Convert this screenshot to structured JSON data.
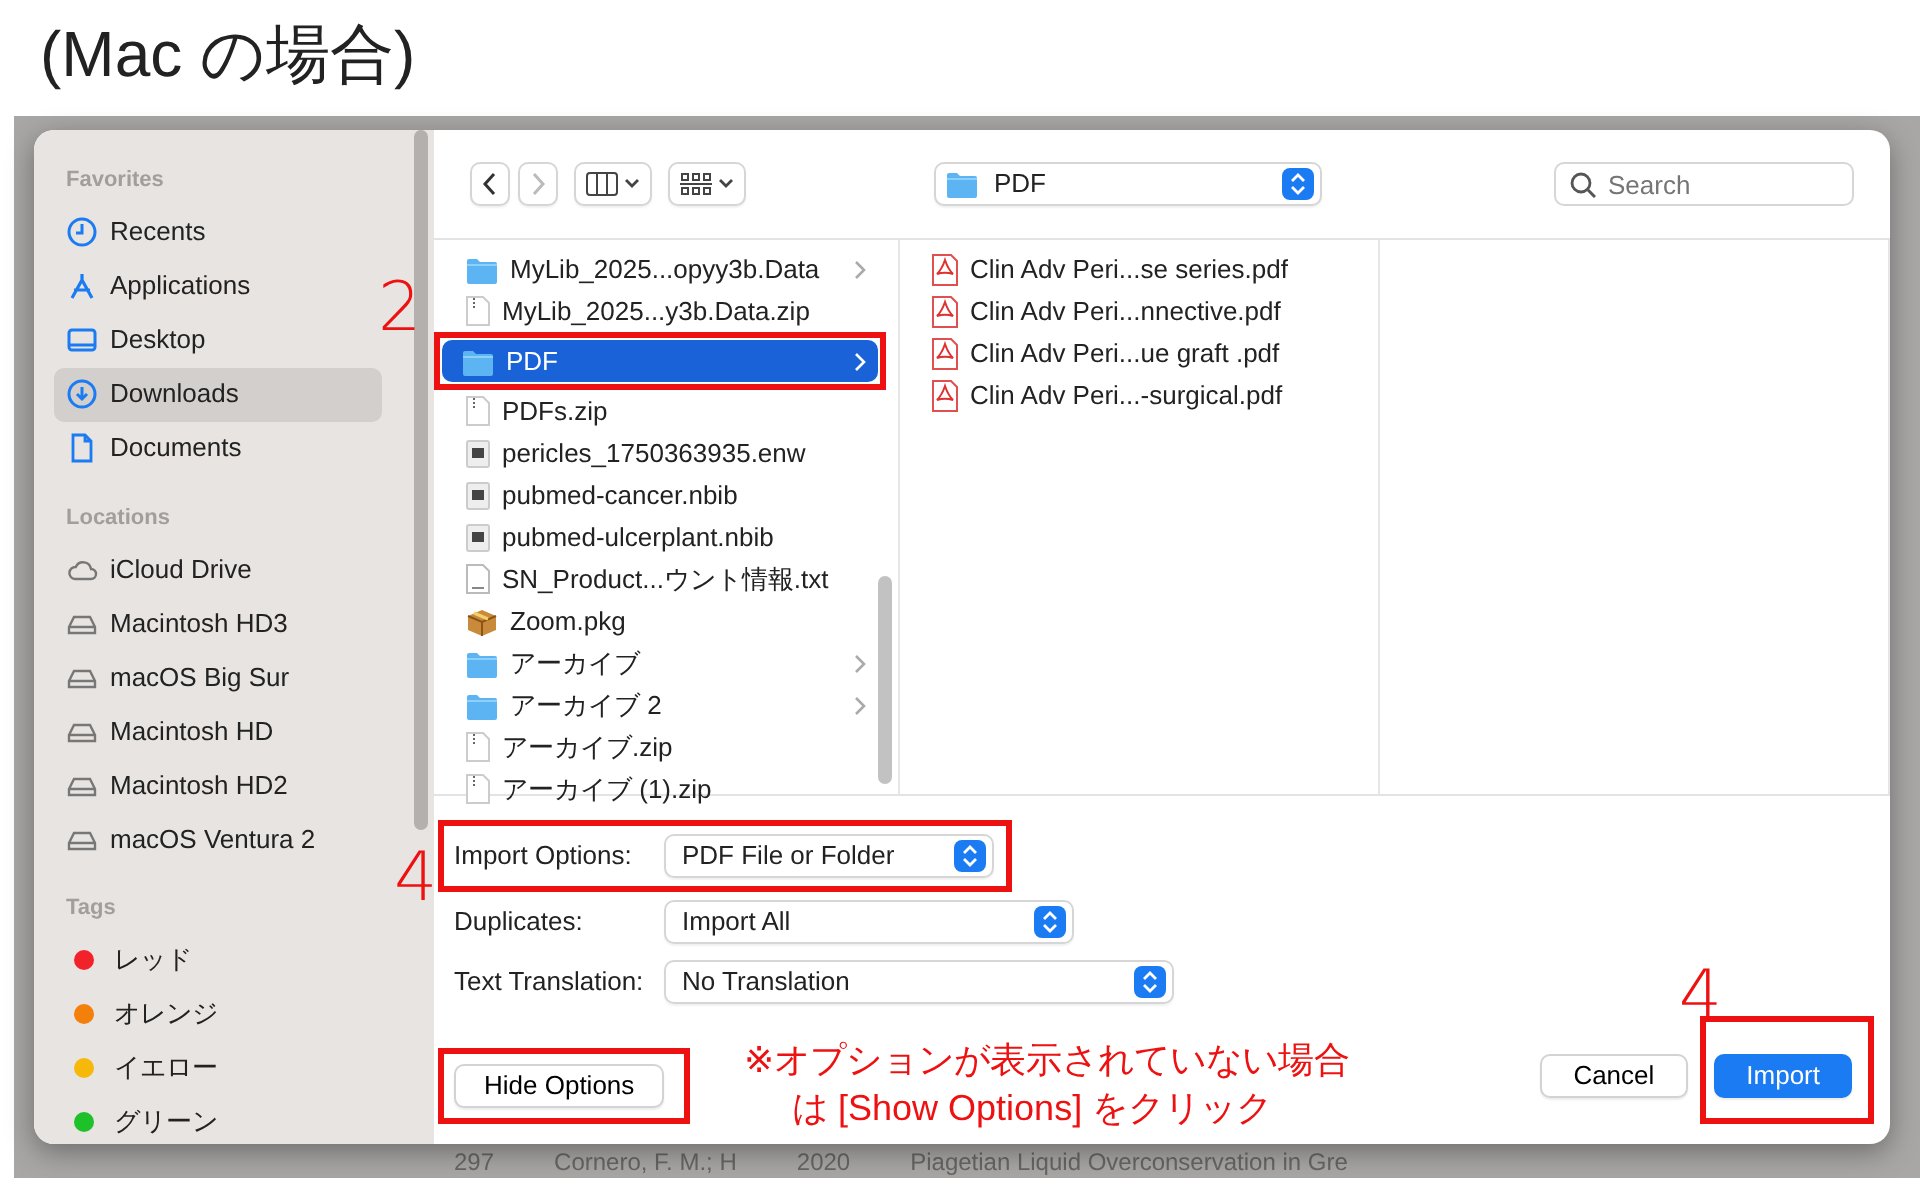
{
  "heading": "(Mac の場合)",
  "sidebar": [
    {
      "title": "Favorites",
      "items": [
        {
          "label": "Recents",
          "kind": "clock",
          "selected": false
        },
        {
          "label": "Applications",
          "kind": "apps",
          "selected": false
        },
        {
          "label": "Desktop",
          "kind": "desktop",
          "selected": false
        },
        {
          "label": "Downloads",
          "kind": "download",
          "selected": true
        },
        {
          "label": "Documents",
          "kind": "document",
          "selected": false
        }
      ]
    },
    {
      "title": "Locations",
      "items": [
        {
          "label": "iCloud Drive",
          "kind": "cloud",
          "selected": false
        },
        {
          "label": "Macintosh HD3",
          "kind": "disk",
          "selected": false
        },
        {
          "label": "macOS Big Sur",
          "kind": "disk",
          "selected": false
        },
        {
          "label": "Macintosh HD",
          "kind": "disk",
          "selected": false
        },
        {
          "label": "Macintosh HD2",
          "kind": "disk",
          "selected": false
        },
        {
          "label": "macOS Ventura 2",
          "kind": "disk",
          "selected": false
        }
      ]
    },
    {
      "title": "Tags",
      "items": [
        {
          "label": "レッド",
          "color": "#f2222a",
          "selected": false
        },
        {
          "label": "オレンジ",
          "color": "#f4800c",
          "selected": false
        },
        {
          "label": "イエロー",
          "color": "#f6b80a",
          "selected": false
        },
        {
          "label": "グリーン",
          "color": "#1fc12a",
          "selected": false
        }
      ]
    }
  ],
  "toolbar": {
    "path": "PDF",
    "search": {
      "placeholder": "Search"
    }
  },
  "columns": [
    {
      "items": [
        {
          "name": "MyLib_2025...opyy3b.Data",
          "kind": "folder",
          "selected": false,
          "annotated": false
        },
        {
          "name": "MyLib_2025...y3b.Data.zip",
          "kind": "zip",
          "selected": false,
          "annotated": false
        },
        {
          "name": "PDF",
          "kind": "folder",
          "selected": true,
          "annotated": true
        },
        {
          "name": "PDFs.zip",
          "kind": "zip",
          "selected": false,
          "annotated": false
        },
        {
          "name": "pericles_1750363935.enw",
          "kind": "data",
          "selected": false,
          "annotated": false
        },
        {
          "name": "pubmed-cancer.nbib",
          "kind": "data",
          "selected": false,
          "annotated": false
        },
        {
          "name": "pubmed-ulcerplant.nbib",
          "kind": "data",
          "selected": false,
          "annotated": false
        },
        {
          "name": "SN_Product...ウント情報.txt",
          "kind": "text",
          "selected": false,
          "annotated": false
        },
        {
          "name": "Zoom.pkg",
          "kind": "package",
          "selected": false,
          "annotated": false
        },
        {
          "name": "アーカイブ",
          "kind": "folder",
          "selected": false,
          "annotated": false
        },
        {
          "name": "アーカイブ 2",
          "kind": "folder",
          "selected": false,
          "annotated": false
        },
        {
          "name": "アーカイブ.zip",
          "kind": "zip",
          "selected": false,
          "annotated": false
        },
        {
          "name": "アーカイブ (1).zip",
          "kind": "zip",
          "selected": false,
          "annotated": false
        }
      ]
    },
    {
      "items": [
        {
          "name": "Clin Adv Peri...se series.pdf",
          "kind": "pdf",
          "selected": false,
          "annotated": false
        },
        {
          "name": "Clin Adv Peri...nnective.pdf",
          "kind": "pdf",
          "selected": false,
          "annotated": false
        },
        {
          "name": "Clin Adv Peri...ue graft .pdf",
          "kind": "pdf",
          "selected": false,
          "annotated": false
        },
        {
          "name": "Clin Adv Peri...-surgical.pdf",
          "kind": "pdf",
          "selected": false,
          "annotated": false
        }
      ]
    }
  ],
  "options": [
    {
      "label": "Import Options:",
      "value": "PDF File or Folder",
      "annotated": true
    },
    {
      "label": "Duplicates:",
      "value": "Import All",
      "annotated": false
    },
    {
      "label": "Text Translation:",
      "value": "No Translation",
      "annotated": false
    }
  ],
  "buttons": [
    {
      "label": "Hide Options",
      "kind": "secondary",
      "annotated": true
    },
    {
      "label": "Cancel",
      "kind": "secondary",
      "annotated": false
    },
    {
      "label": "Import",
      "kind": "default",
      "annotated": true
    }
  ],
  "annotations": {
    "step_marks": [
      "2",
      "4",
      "4"
    ],
    "note": [
      "※オプションが表示されていない場合",
      "は [Show Options] をクリック"
    ]
  },
  "background_row": [
    "297",
    "Cornero, F. M.; H",
    "2020",
    "Piagetian Liquid Overconservation in Gre"
  ]
}
